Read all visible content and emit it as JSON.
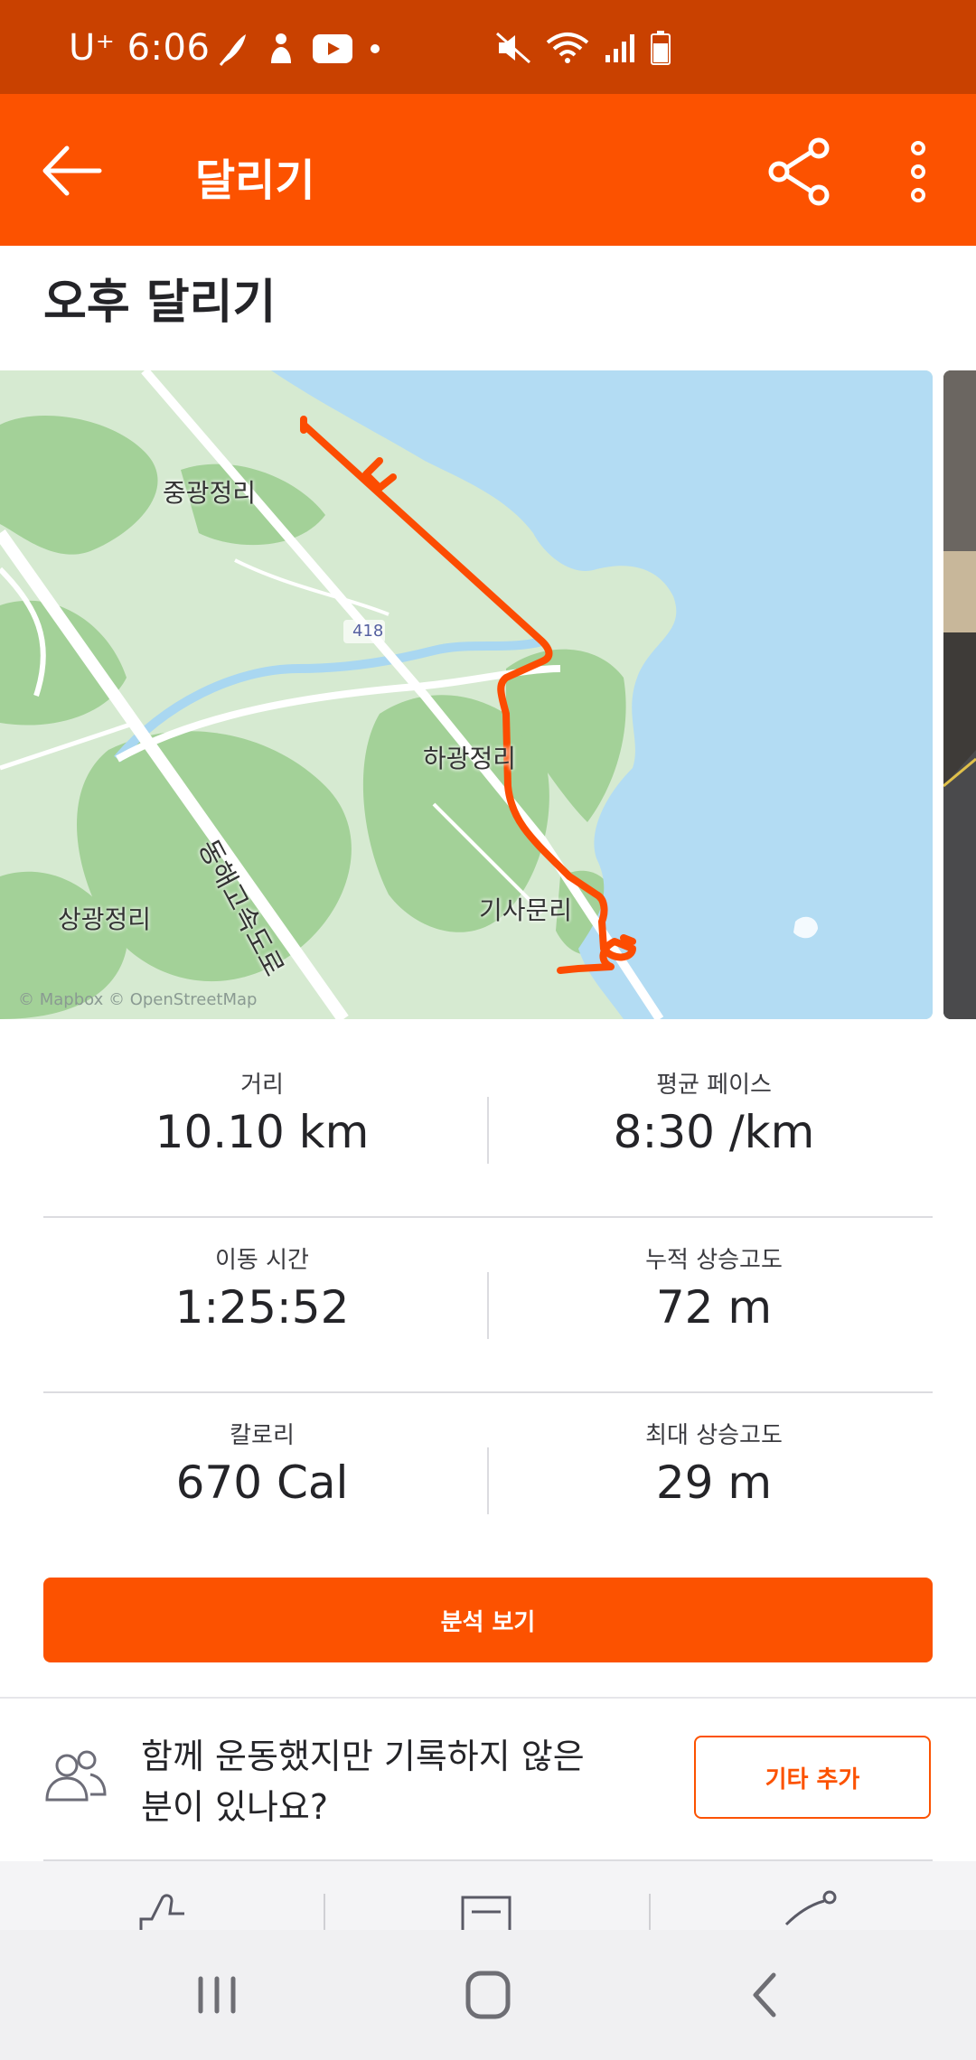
{
  "status_bar": {
    "carrier": "U⁺",
    "time": "6:06"
  },
  "app_bar": {
    "title": "달리기",
    "icons": [
      "back-arrow-icon",
      "share-icon",
      "more-vert-icon"
    ]
  },
  "activity": {
    "name": "오후 달리기"
  },
  "map": {
    "labels": {
      "junggwang": "중광정리",
      "hagwang": "하광정리",
      "sanggwang": "상광정리",
      "gisamun": "기사문리",
      "route_number": "418",
      "expressway": "동해고속도로"
    },
    "credit": "© Mapbox © OpenStreetMap",
    "colors": {
      "land": "#d7ead2",
      "forest": "#9fcf95",
      "water": "#b3dcf3",
      "route": "#fc4c02"
    }
  },
  "stats": {
    "distance": {
      "label": "거리",
      "value": "10.10 km"
    },
    "avg_pace": {
      "label": "평균 페이스",
      "value": "8:30 /km"
    },
    "moving_time": {
      "label": "이동 시간",
      "value": "1:25:52"
    },
    "elev_gain": {
      "label": "누적 상승고도",
      "value": "72 m"
    },
    "calories": {
      "label": "칼로리",
      "value": "670 Cal"
    },
    "max_elev": {
      "label": "최대 상승고도",
      "value": "29 m"
    }
  },
  "analysis_button": {
    "label": "분석 보기"
  },
  "add_others": {
    "question_line1": "함께 운동했지만 기록하지 않은",
    "question_line2": "분이 있나요?",
    "button_label": "기타 추가"
  },
  "action_bar": {
    "icons": [
      "thumbs-up-icon",
      "comment-icon",
      "share-route-icon"
    ]
  },
  "nav_bar": {
    "icons": [
      "recent-apps-icon",
      "home-icon",
      "back-icon"
    ]
  },
  "theme": {
    "brand": "#fc5200",
    "status_bar": "#c94100"
  }
}
